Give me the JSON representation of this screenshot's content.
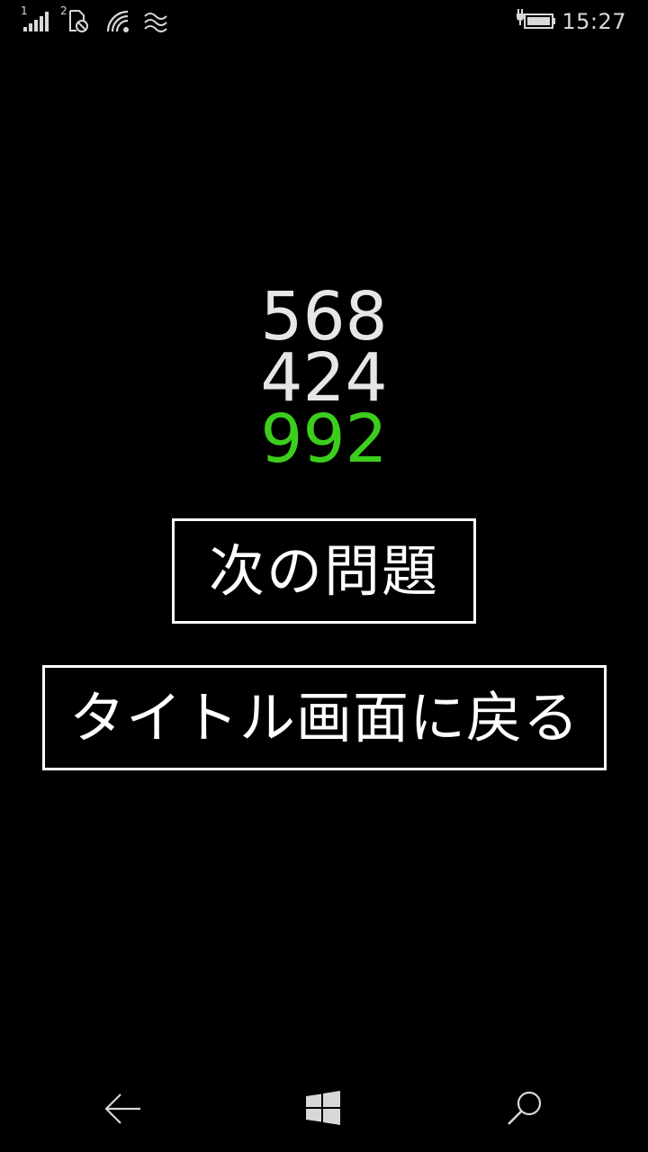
{
  "status_bar": {
    "sim1_label": "1",
    "sim2_label": "2",
    "icons": [
      "signal-bars-icon",
      "no-sim-icon",
      "wifi-icon",
      "data-wave-icon",
      "battery-charging-icon"
    ],
    "time": "15:27"
  },
  "problem": {
    "operand1": "568",
    "operand2": "424",
    "answer": "992",
    "answer_color": "#3ccd1d"
  },
  "buttons": {
    "next_label": "次の問題",
    "title_label": "タイトル画面に戻る"
  },
  "nav_bar": {
    "icons": [
      "back-arrow-icon",
      "windows-start-icon",
      "search-icon"
    ]
  }
}
